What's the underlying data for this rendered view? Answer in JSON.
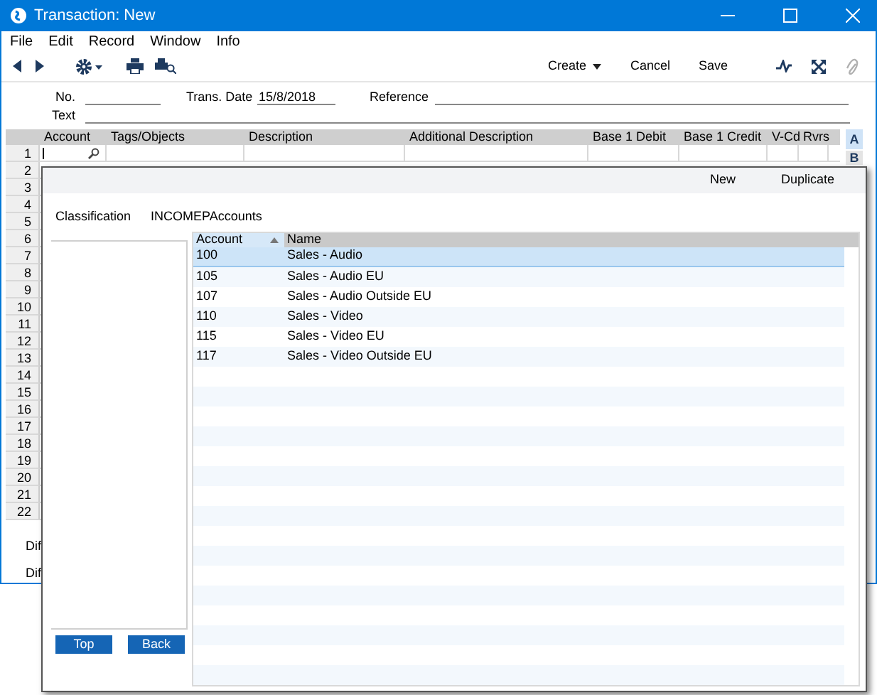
{
  "window": {
    "title": "Transaction: New"
  },
  "menu": [
    "File",
    "Edit",
    "Record",
    "Window",
    "Info"
  ],
  "toolbar": {
    "buttons": [
      {
        "label": "Create",
        "dropdown": true
      },
      {
        "label": "Cancel",
        "dropdown": false
      },
      {
        "label": "Save",
        "dropdown": false
      }
    ]
  },
  "header_fields": [
    {
      "label": "No."
    },
    {
      "label": "Trans. Date",
      "value": "15/8/2018"
    },
    {
      "label": "Reference"
    },
    {
      "label": "Text"
    }
  ],
  "grid": {
    "columns": [
      "Account",
      "Tags/Objects",
      "Description",
      "Additional Description",
      "Base 1 Debit",
      "Base 1 Credit",
      "V-Cd",
      "Rvrs"
    ],
    "row_numbers": [
      "1",
      "2",
      "3",
      "4",
      "5",
      "6",
      "7",
      "8",
      "9",
      "10",
      "11",
      "12",
      "13",
      "14",
      "15",
      "16",
      "17",
      "18",
      "19",
      "20",
      "21",
      "22"
    ]
  },
  "side_tabs": [
    {
      "label": "A",
      "selected": true
    },
    {
      "label": "B",
      "selected": false
    }
  ],
  "footer_labels": [
    "Dif",
    "Dif"
  ],
  "popup": {
    "actions": [
      "New",
      "Duplicate"
    ],
    "classification": {
      "label": "Classification",
      "value": "INCOMEPAccounts"
    },
    "list": {
      "columns": [
        {
          "label": "Account",
          "sorted": true
        },
        {
          "label": "Name",
          "sorted": false
        }
      ],
      "rows": [
        {
          "account": "100",
          "name": "Sales - Audio",
          "selected": true
        },
        {
          "account": "105",
          "name": "Sales - Audio EU",
          "selected": false
        },
        {
          "account": "107",
          "name": "Sales - Audio Outside EU",
          "selected": false
        },
        {
          "account": "110",
          "name": "Sales - Video",
          "selected": false
        },
        {
          "account": "115",
          "name": "Sales - Video EU",
          "selected": false
        },
        {
          "account": "117",
          "name": "Sales - Video Outside EU",
          "selected": false
        }
      ]
    },
    "buttons": [
      "Top",
      "Back"
    ]
  }
}
